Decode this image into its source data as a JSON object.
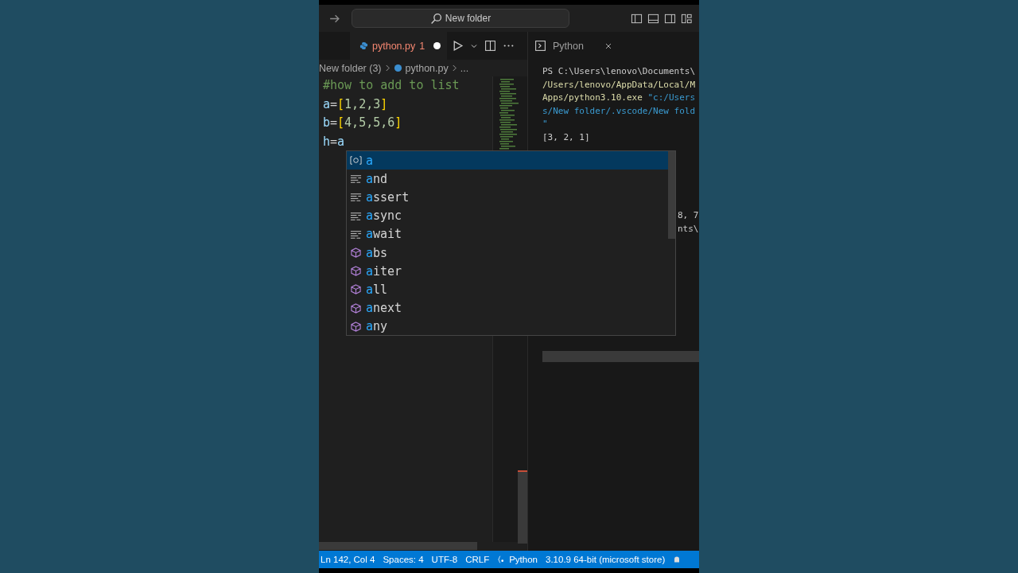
{
  "titlebar": {
    "search": "New folder"
  },
  "editor": {
    "tab": {
      "label": "python.py",
      "problems": "1",
      "modified": true
    },
    "breadcrumb": [
      "New folder (3)",
      "python.py",
      "..."
    ],
    "code": [
      {
        "tokens": [
          {
            "text": "#how to add to list",
            "kind": "comment"
          }
        ]
      },
      {
        "tokens": [
          {
            "text": "a",
            "kind": "name"
          },
          {
            "text": "=",
            "kind": "op"
          },
          {
            "text": "[",
            "kind": "bracket"
          },
          {
            "text": "1,2,3",
            "kind": "number"
          },
          {
            "text": "]",
            "kind": "bracket"
          }
        ]
      },
      {
        "tokens": [
          {
            "text": "b",
            "kind": "name"
          },
          {
            "text": "=",
            "kind": "op"
          },
          {
            "text": "[",
            "kind": "bracket"
          },
          {
            "text": "4,5,5,6",
            "kind": "number"
          },
          {
            "text": "]",
            "kind": "bracket"
          }
        ]
      },
      {
        "tokens": [
          {
            "text": "h",
            "kind": "name"
          },
          {
            "text": "=",
            "kind": "op"
          },
          {
            "text": "a",
            "kind": "name"
          }
        ]
      }
    ]
  },
  "suggest": {
    "items": [
      {
        "label": "a",
        "kind": "variable",
        "selected": true
      },
      {
        "label": "and",
        "kind": "keyword",
        "selected": false
      },
      {
        "label": "assert",
        "kind": "keyword",
        "selected": false
      },
      {
        "label": "async",
        "kind": "keyword",
        "selected": false
      },
      {
        "label": "await",
        "kind": "keyword",
        "selected": false
      },
      {
        "label": "abs",
        "kind": "function",
        "selected": false
      },
      {
        "label": "aiter",
        "kind": "function",
        "selected": false
      },
      {
        "label": "all",
        "kind": "function",
        "selected": false
      },
      {
        "label": "anext",
        "kind": "function",
        "selected": false
      },
      {
        "label": "any",
        "kind": "function",
        "selected": false
      }
    ]
  },
  "terminal": {
    "tab": "Python",
    "lines": [
      {
        "kind": "full",
        "tokens": [
          {
            "text": "PS C:\\Users\\lenovo\\Documents\\",
            "kind": "plain"
          }
        ]
      },
      {
        "kind": "full",
        "tokens": [
          {
            "text": "/Users/lenovo/AppData/Local/M",
            "kind": "path"
          }
        ]
      },
      {
        "kind": "full",
        "tokens": [
          {
            "text": "Apps/python3.10.exe ",
            "kind": "path"
          },
          {
            "text": "\"c:/Users",
            "kind": "string"
          }
        ]
      },
      {
        "kind": "full",
        "tokens": [
          {
            "text": "s/New folder/.vscode/New fold",
            "kind": "string"
          }
        ]
      },
      {
        "kind": "full",
        "tokens": [
          {
            "text": "\"",
            "kind": "string"
          }
        ]
      },
      {
        "kind": "full",
        "tokens": [
          {
            "text": "[3, 2, 1]",
            "kind": "plain"
          }
        ]
      },
      {
        "kind": "tail",
        "tokens": [
          {
            "text": "8, 7",
            "kind": "plain"
          }
        ]
      },
      {
        "kind": "tail",
        "tokens": [
          {
            "text": "nts\\",
            "kind": "plain"
          }
        ]
      }
    ]
  },
  "status_bar": [
    {
      "text": "Ln 142, Col 4",
      "kind": "plain"
    },
    {
      "text": "Spaces: 4",
      "kind": "plain"
    },
    {
      "text": "UTF-8",
      "kind": "plain"
    },
    {
      "text": "CRLF",
      "kind": "plain"
    },
    {
      "text": "Python",
      "kind": "language"
    },
    {
      "text": "3.10.9 64-bit (microsoft store)",
      "kind": "plain"
    }
  ]
}
